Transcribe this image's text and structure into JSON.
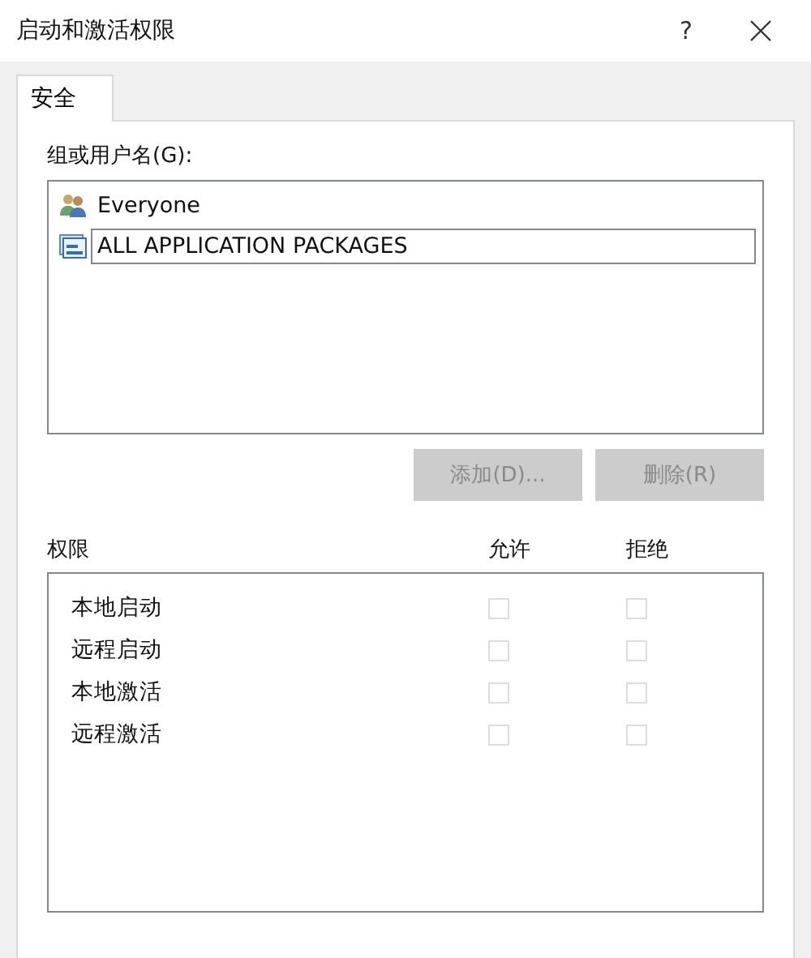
{
  "window": {
    "title": "启动和激活权限",
    "help": "?"
  },
  "tabs": [
    {
      "label": "安全",
      "selected": true
    }
  ],
  "principals": {
    "label": "组或用户名(G):",
    "items": [
      {
        "name": "Everyone",
        "kind": "group",
        "selected": false
      },
      {
        "name": "ALL APPLICATION PACKAGES",
        "kind": "package",
        "selected": true
      }
    ]
  },
  "buttons": [
    {
      "label": "添加(D)...",
      "disabled": true
    },
    {
      "label": "删除(R)",
      "disabled": true
    }
  ],
  "permissions": {
    "label": "权限",
    "columns": [
      "允许",
      "拒绝"
    ],
    "rows": [
      {
        "name": "本地启动",
        "allow": false,
        "deny": false,
        "disabled": true
      },
      {
        "name": "远程启动",
        "allow": false,
        "deny": false,
        "disabled": true
      },
      {
        "name": "本地激活",
        "allow": false,
        "deny": false,
        "disabled": true
      },
      {
        "name": "远程激活",
        "allow": false,
        "deny": false,
        "disabled": true
      }
    ]
  }
}
